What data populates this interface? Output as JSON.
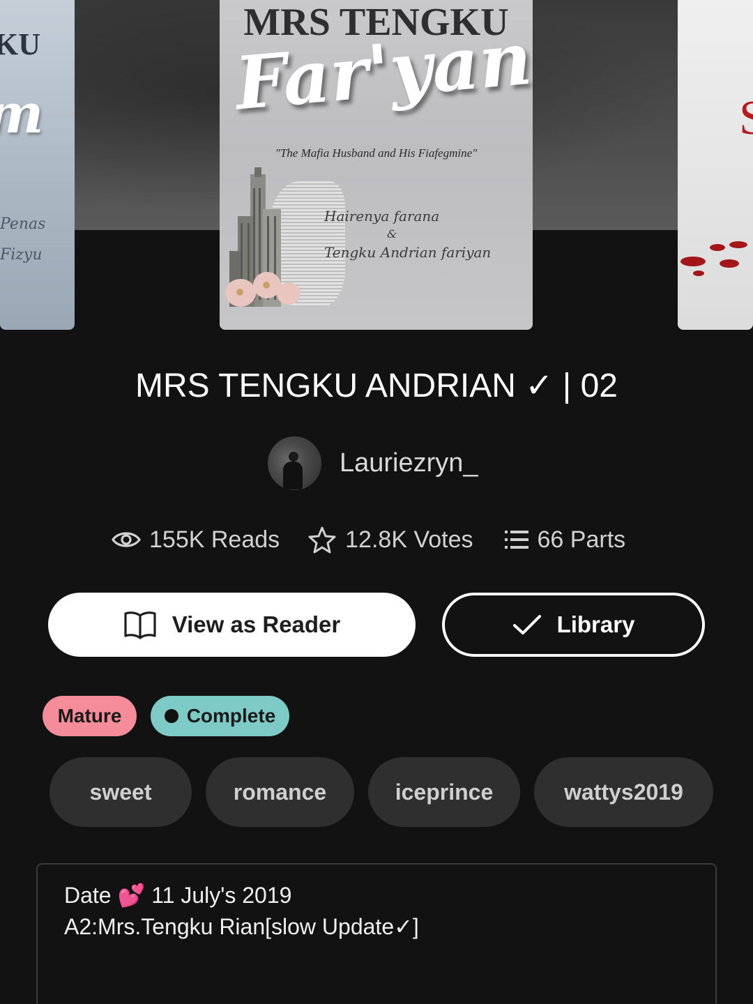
{
  "covers": {
    "left": {
      "title_fragment": "KU",
      "script_fragment": "m",
      "names_fragment": [
        "Penas",
        "Fizyu"
      ]
    },
    "main": {
      "title_top": "MRS TENGKU",
      "script_title": "Far'yan",
      "tagline": "\"The Mafia Husband and His Fiafegmine\"",
      "names": [
        "Hairenya farana",
        "&",
        "Tengku Andrian fariyan"
      ]
    },
    "right": {
      "letter_fragment": "S"
    }
  },
  "story": {
    "title": "MRS TENGKU ANDRIAN ✓ | 02",
    "author": "Lauriezryn_"
  },
  "stats": {
    "reads": "155K Reads",
    "votes": "12.8K Votes",
    "parts": "66 Parts"
  },
  "actions": {
    "reader_label": "View as Reader",
    "library_label": "Library"
  },
  "badges": {
    "mature": "Mature",
    "complete": "Complete"
  },
  "tags": [
    "sweet",
    "romance",
    "iceprince",
    "wattys2019"
  ],
  "description": {
    "line1": "Date 💕 11 July's 2019",
    "line2": "A2:Mrs.Tengku Rian[slow Update✓]"
  },
  "colors": {
    "background": "#121212",
    "mature_badge": "#f48c9a",
    "complete_badge": "#7ecac6",
    "tag_bg": "#2f2f2f"
  },
  "icons": {
    "reads": "eye-icon",
    "votes": "star-icon",
    "parts": "list-icon",
    "reader": "open-book-icon",
    "library": "checkmark-icon"
  }
}
